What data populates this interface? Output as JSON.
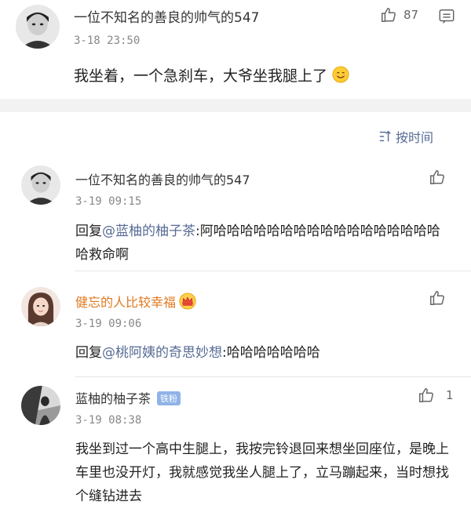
{
  "main_post": {
    "username": "一位不知名的善良的帅气的547",
    "time": "3-18 23:50",
    "like_count": "87",
    "content": "我坐着，一个急刹车，大爷坐我腿上了"
  },
  "sort": {
    "label": "按时间"
  },
  "comments": [
    {
      "username": "一位不知名的善良的帅气的547",
      "time": "3-19 09:15",
      "reply_prefix": "回复",
      "mention": "@蓝柚的柚子茶",
      "text": ":阿哈哈哈哈哈哈哈哈哈哈哈哈哈哈哈哈哈哈救命啊"
    },
    {
      "username": "健忘的人比较幸福",
      "time": "3-19 09:06",
      "reply_prefix": "回复",
      "mention": "@桃阿姨的奇思妙想",
      "text": ":哈哈哈哈哈哈哈"
    },
    {
      "username": "蓝柚的柚子茶",
      "badge": "铁粉",
      "time": "3-19 08:38",
      "like_count": "1",
      "text": "我坐到过一个高中生腿上，我按完铃退回来想坐回座位，是晚上车里也没开灯，我就感觉我坐人腿上了，立马蹦起来，当时想找个缝钻进去"
    }
  ],
  "colors": {
    "link": "#576b95",
    "vip_name": "#e07a20",
    "divider_bg": "#f2f2f2"
  },
  "icons": [
    "thumbs-up-icon",
    "message-icon",
    "sort-icon",
    "smile-emoji-icon",
    "crown-icon"
  ]
}
